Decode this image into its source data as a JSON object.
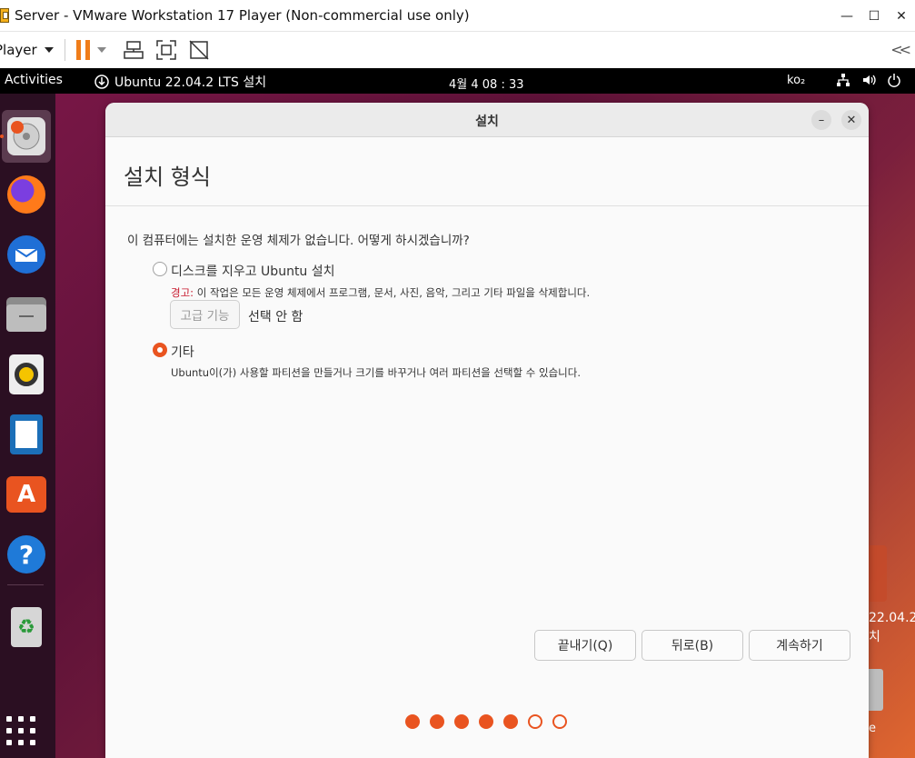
{
  "vmware": {
    "title": "Server - VMware Workstation 17 Player (Non-commercial use only)",
    "player_menu": "Player"
  },
  "gnome": {
    "activities": "Activities",
    "app_name": "Ubuntu 22.04.2 LTS 설치",
    "clock": "4월 4  08 : 33",
    "ime": "ko₂"
  },
  "desktop": {
    "icon_label_line1": "22.04.2",
    "icon_label_line2": "치",
    "icon_label2": "e"
  },
  "installer": {
    "window_title": "설치",
    "page_title": "설치 형식",
    "question": "이 컴퓨터에는 설치한 운영 체제가 없습니다. 어떻게 하시겠습니까?",
    "option_erase": {
      "label": "디스크를 지우고 Ubuntu 설치",
      "warning_prefix": "경고:",
      "warning": " 이 작업은 모든 운영 체제에서 프로그램, 문서, 사진, 음악, 그리고 기타 파일을 삭제합니다.",
      "advanced_button": "고급 기능",
      "advanced_state": "선택 안 함",
      "selected": false
    },
    "option_other": {
      "label": "기타",
      "description": "Ubuntu이(가) 사용할 파티션을 만들거나 크기를 바꾸거나 여러 파티션을 선택할 수 있습니다.",
      "selected": true
    },
    "buttons": {
      "quit": "끝내기(Q)",
      "back": "뒤로(B)",
      "continue": "계속하기"
    },
    "progress": {
      "total_steps": 7,
      "completed_steps": 5
    }
  },
  "colors": {
    "accent": "#e95420",
    "vm_pause": "#f07d1a",
    "warning": "#c7162b"
  }
}
